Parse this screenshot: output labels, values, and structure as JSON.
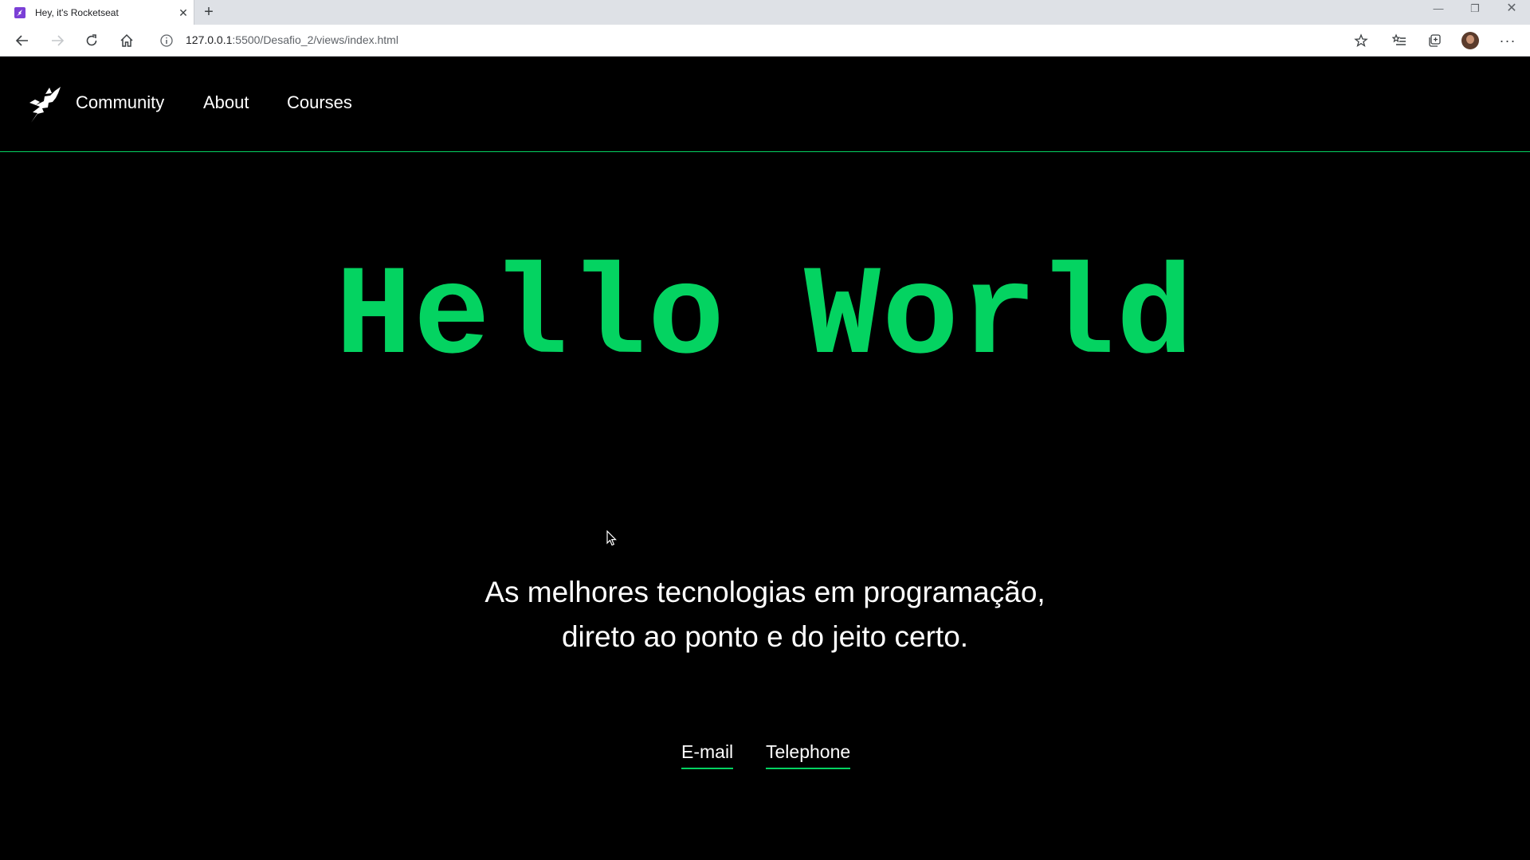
{
  "browser": {
    "tab_title": "Hey, it's Rocketseat",
    "tab_close": "✕",
    "new_tab": "+",
    "url_host": "127.0.0.1",
    "url_rest": ":5500/Desafio_2/views/index.html",
    "window_controls": {
      "minimize": "—",
      "restore": "❐",
      "close": "✕"
    },
    "menu": "···",
    "favicon_color": "#7b3fd6"
  },
  "site": {
    "nav": {
      "community": "Community",
      "about": "About",
      "courses": "Courses"
    },
    "hero_title": "Hello World",
    "tagline_line1": "As melhores tecnologias em programação,",
    "tagline_line2": "direto ao ponto e do jeito certo.",
    "links": {
      "email": "E-mail",
      "telephone": "Telephone"
    }
  },
  "colors": {
    "accent": "#04d361",
    "background": "#000000",
    "text": "#ffffff"
  }
}
